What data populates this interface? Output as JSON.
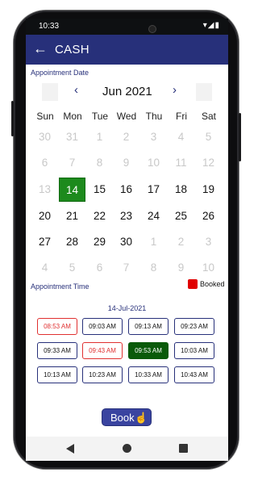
{
  "status": {
    "time": "10:33",
    "icons": "▾◢▮"
  },
  "appbar": {
    "title": "CASH"
  },
  "calendar": {
    "label": "Appointment Date",
    "month": "Jun 2021",
    "weekdays": [
      "Sun",
      "Mon",
      "Tue",
      "Wed",
      "Thu",
      "Fri",
      "Sat"
    ],
    "weeks": [
      [
        {
          "d": "30",
          "m": "dim"
        },
        {
          "d": "31",
          "m": "dim"
        },
        {
          "d": "1",
          "m": "dim"
        },
        {
          "d": "2",
          "m": "dim"
        },
        {
          "d": "3",
          "m": "dim"
        },
        {
          "d": "4",
          "m": "dim"
        },
        {
          "d": "5",
          "m": "dim"
        }
      ],
      [
        {
          "d": "6",
          "m": "dim"
        },
        {
          "d": "7",
          "m": "dim"
        },
        {
          "d": "8",
          "m": "dim"
        },
        {
          "d": "9",
          "m": "dim"
        },
        {
          "d": "10",
          "m": "dim"
        },
        {
          "d": "11",
          "m": "dim"
        },
        {
          "d": "12",
          "m": "dim"
        }
      ],
      [
        {
          "d": "13",
          "m": "dim"
        },
        {
          "d": "14",
          "m": "sel"
        },
        {
          "d": "15",
          "m": "act"
        },
        {
          "d": "16",
          "m": "act"
        },
        {
          "d": "17",
          "m": "act"
        },
        {
          "d": "18",
          "m": "act"
        },
        {
          "d": "19",
          "m": "act"
        }
      ],
      [
        {
          "d": "20",
          "m": "act"
        },
        {
          "d": "21",
          "m": "act"
        },
        {
          "d": "22",
          "m": "act"
        },
        {
          "d": "23",
          "m": "act"
        },
        {
          "d": "24",
          "m": "act"
        },
        {
          "d": "25",
          "m": "act"
        },
        {
          "d": "26",
          "m": "act"
        }
      ],
      [
        {
          "d": "27",
          "m": "act"
        },
        {
          "d": "28",
          "m": "act"
        },
        {
          "d": "29",
          "m": "act"
        },
        {
          "d": "30",
          "m": "act"
        },
        {
          "d": "1",
          "m": "dim"
        },
        {
          "d": "2",
          "m": "dim"
        },
        {
          "d": "3",
          "m": "dim"
        }
      ],
      [
        {
          "d": "4",
          "m": "dim"
        },
        {
          "d": "5",
          "m": "dim"
        },
        {
          "d": "6",
          "m": "dim"
        },
        {
          "d": "7",
          "m": "dim"
        },
        {
          "d": "8",
          "m": "dim"
        },
        {
          "d": "9",
          "m": "dim"
        },
        {
          "d": "10",
          "m": "dim"
        }
      ]
    ]
  },
  "times": {
    "label": "Appointment Time",
    "legend": "Booked",
    "selected_date": "14-Jul-2021",
    "slots": [
      {
        "t": "08:53 AM",
        "s": "booked"
      },
      {
        "t": "09:03 AM",
        "s": "open"
      },
      {
        "t": "09:13 AM",
        "s": "open"
      },
      {
        "t": "09:23 AM",
        "s": "open"
      },
      {
        "t": "09:33 AM",
        "s": "open"
      },
      {
        "t": "09:43 AM",
        "s": "booked"
      },
      {
        "t": "09:53 AM",
        "s": "active"
      },
      {
        "t": "10:03 AM",
        "s": "open"
      },
      {
        "t": "10:13 AM",
        "s": "open"
      },
      {
        "t": "10:23 AM",
        "s": "open"
      },
      {
        "t": "10:33 AM",
        "s": "open"
      },
      {
        "t": "10:43 AM",
        "s": "open"
      }
    ]
  },
  "book_button": {
    "label": "Book"
  },
  "colors": {
    "primary": "#27307a",
    "selected_day": "#1d8a1d",
    "booked": "#e00000",
    "active_slot": "#0a5a0a"
  }
}
